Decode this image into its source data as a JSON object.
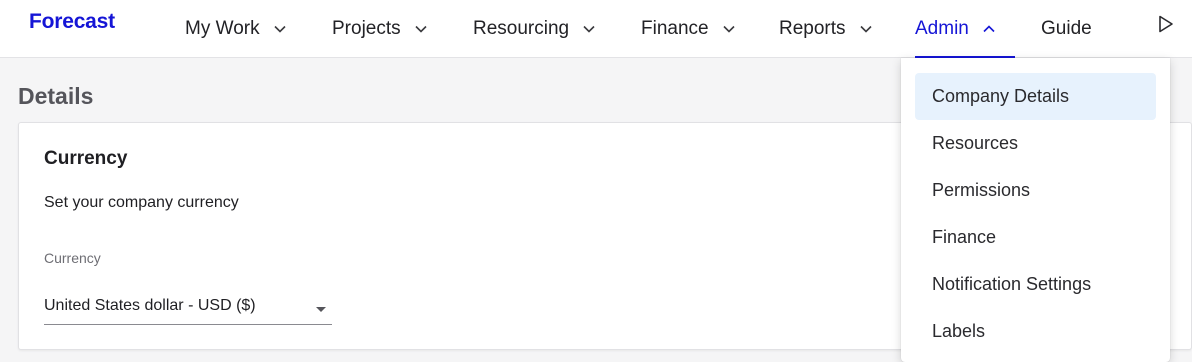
{
  "app": {
    "logo": "Forecast",
    "accent_color": "#1515d6"
  },
  "nav": {
    "items": [
      {
        "label": "My Work",
        "has_menu": true
      },
      {
        "label": "Projects",
        "has_menu": true
      },
      {
        "label": "Resourcing",
        "has_menu": true
      },
      {
        "label": "Finance",
        "has_menu": true
      },
      {
        "label": "Reports",
        "has_menu": true
      },
      {
        "label": "Admin",
        "has_menu": true,
        "active": true
      },
      {
        "label": "Guide",
        "has_menu": false
      }
    ],
    "right_icon": "play-icon"
  },
  "page": {
    "title": "Details",
    "card": {
      "title": "Currency",
      "description": "Set your company currency",
      "field_label": "Currency",
      "field_value": "United States dollar - USD ($)"
    }
  },
  "admin_menu": {
    "items": [
      {
        "label": "Company Details",
        "selected": true
      },
      {
        "label": "Resources"
      },
      {
        "label": "Permissions"
      },
      {
        "label": "Finance"
      },
      {
        "label": "Notification Settings"
      },
      {
        "label": "Labels"
      }
    ],
    "selected_bg": "#e7f2fd"
  }
}
